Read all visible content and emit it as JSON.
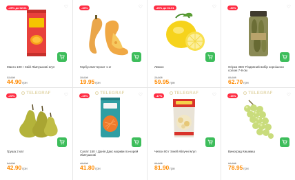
{
  "products": [
    {
      "badge": "-25% до 02.01",
      "name": "Манго 100 г Свій Лімпушкові м'ул",
      "old_price": "52.99₴",
      "price": "44.90",
      "currency": "грн"
    },
    {
      "badge": "-33%",
      "name": "Гарбуз Баттернат 1 кг",
      "old_price": "29.90₴",
      "price": "19.95",
      "currency": "грн"
    },
    {
      "badge": "-25% до 02.01",
      "name": "Лимон",
      "old_price": "79.90₴",
      "price": "59.95",
      "currency": "грн"
    },
    {
      "badge": "-30%",
      "name": "Огірки 350г Різдвяний вибір корнішони солоні 7-9 см",
      "old_price": "89.90₴",
      "price": "62.70",
      "currency": "грн"
    },
    {
      "badge": "-20%",
      "name": "Груша 2 кат",
      "old_price": "54.90₴",
      "price": "42.90",
      "currency": "грн"
    },
    {
      "badge": "-16%",
      "name": "Салат 150 г Данія Дакс моркви по-корей Лімпушкові",
      "old_price": "49.90₴",
      "price": "41.80",
      "currency": "грн"
    },
    {
      "badge": "-17%",
      "name": "Чипси 80 г Swell яблучні м'ул",
      "old_price": "99.90₴",
      "price": "81.90",
      "currency": "грн"
    },
    {
      "badge": "-16%",
      "name": "Виноград Кишмиш",
      "old_price": "94.90₴",
      "price": "78.95",
      "currency": "грн"
    }
  ],
  "watermark": "TELEGRAF",
  "icons": {
    "favorite": "heart-outline-icon",
    "add_to_cart": "cart-icon"
  },
  "colors": {
    "badge": "#ff2d43",
    "price": "#ff8a00",
    "cart_button": "#3dbd5b",
    "watermark": "#e2d6a8"
  }
}
